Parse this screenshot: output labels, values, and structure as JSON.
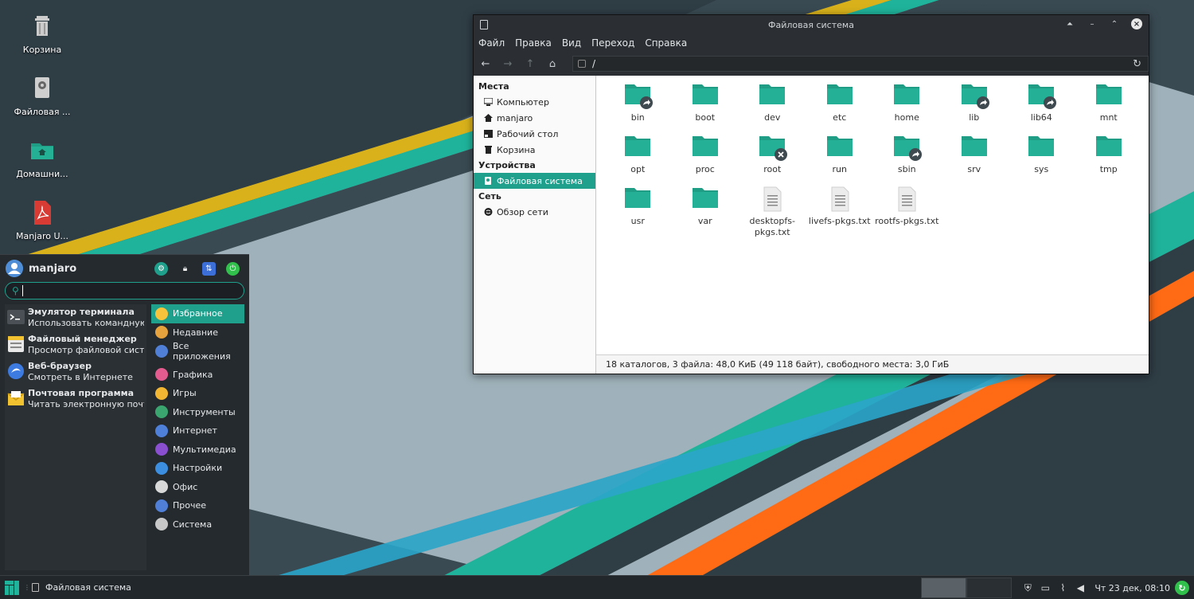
{
  "desktop": {
    "icons": [
      {
        "label": "Корзина",
        "icon": "trash-icon"
      },
      {
        "label": "Файловая ...",
        "icon": "drive-icon"
      },
      {
        "label": "Домашни...",
        "icon": "home-folder-icon"
      },
      {
        "label": "Manjaro U...",
        "icon": "pdf-icon"
      }
    ]
  },
  "file_manager": {
    "title": "Файловая система",
    "menu": [
      "Файл",
      "Правка",
      "Вид",
      "Переход",
      "Справка"
    ],
    "path": "/",
    "sidebar": {
      "places_header": "Места",
      "places": [
        "Компьютер",
        "manjaro",
        "Рабочий стол",
        "Корзина"
      ],
      "devices_header": "Устройства",
      "devices": [
        "Файловая система"
      ],
      "network_header": "Сеть",
      "network": [
        "Обзор сети"
      ]
    },
    "files": [
      {
        "name": "bin",
        "type": "folder-link"
      },
      {
        "name": "boot",
        "type": "folder"
      },
      {
        "name": "dev",
        "type": "folder"
      },
      {
        "name": "etc",
        "type": "folder"
      },
      {
        "name": "home",
        "type": "folder"
      },
      {
        "name": "lib",
        "type": "folder-link"
      },
      {
        "name": "lib64",
        "type": "folder-link"
      },
      {
        "name": "mnt",
        "type": "folder"
      },
      {
        "name": "opt",
        "type": "folder"
      },
      {
        "name": "proc",
        "type": "folder"
      },
      {
        "name": "root",
        "type": "folder-locked"
      },
      {
        "name": "run",
        "type": "folder"
      },
      {
        "name": "sbin",
        "type": "folder-link"
      },
      {
        "name": "srv",
        "type": "folder"
      },
      {
        "name": "sys",
        "type": "folder"
      },
      {
        "name": "tmp",
        "type": "folder"
      },
      {
        "name": "usr",
        "type": "folder"
      },
      {
        "name": "var",
        "type": "folder"
      },
      {
        "name": "desktopfs-pkgs.txt",
        "type": "text"
      },
      {
        "name": "livefs-pkgs.txt",
        "type": "text"
      },
      {
        "name": "rootfs-pkgs.txt",
        "type": "text"
      }
    ],
    "status": "18 каталогов, 3 файла: 48,0 КиБ (49 118 байт), свободного места: 3,0 ГиБ"
  },
  "app_menu": {
    "user": "manjaro",
    "search_value": "",
    "favorites": [
      {
        "title": "Эмулятор терминала",
        "desc": "Использовать командную строку",
        "icon": "terminal-icon"
      },
      {
        "title": "Файловый менеджер",
        "desc": "Просмотр файловой системы",
        "icon": "file-manager-icon"
      },
      {
        "title": "Веб-браузер",
        "desc": "Смотреть в Интернете",
        "icon": "browser-icon"
      },
      {
        "title": "Почтовая программа",
        "desc": "Читать электронную почту",
        "icon": "mail-icon"
      }
    ],
    "categories_top": [
      {
        "label": "Избранное",
        "icon": "star-icon",
        "color": "#f6c33b"
      },
      {
        "label": "Недавние",
        "icon": "clock-icon",
        "color": "#e6a23c"
      },
      {
        "label": "Все приложения",
        "icon": "dots-icon",
        "color": "#4f7fd6"
      }
    ],
    "categories": [
      {
        "label": "Графика",
        "icon": "graphics-icon",
        "color": "#e45b8f"
      },
      {
        "label": "Игры",
        "icon": "gamepad-icon",
        "color": "#f2b632"
      },
      {
        "label": "Инструменты",
        "icon": "tools-icon",
        "color": "#3aa56f"
      },
      {
        "label": "Интернет",
        "icon": "internet-icon",
        "color": "#4e7fd9"
      },
      {
        "label": "Мультимедиа",
        "icon": "multimedia-icon",
        "color": "#8a4fd1"
      },
      {
        "label": "Настройки",
        "icon": "settings-icon",
        "color": "#3b8ee0"
      },
      {
        "label": "Офис",
        "icon": "office-icon",
        "color": "#d8d8d8"
      },
      {
        "label": "Прочее",
        "icon": "other-icon",
        "color": "#4f7fd6"
      },
      {
        "label": "Система",
        "icon": "system-icon",
        "color": "#c8c8c8"
      }
    ]
  },
  "taskbar": {
    "task_label": "Файловая система",
    "clock": "Чт 23 дек, 08:10"
  },
  "colors": {
    "accent": "#1fa08d",
    "folder": "#1f9e85"
  }
}
